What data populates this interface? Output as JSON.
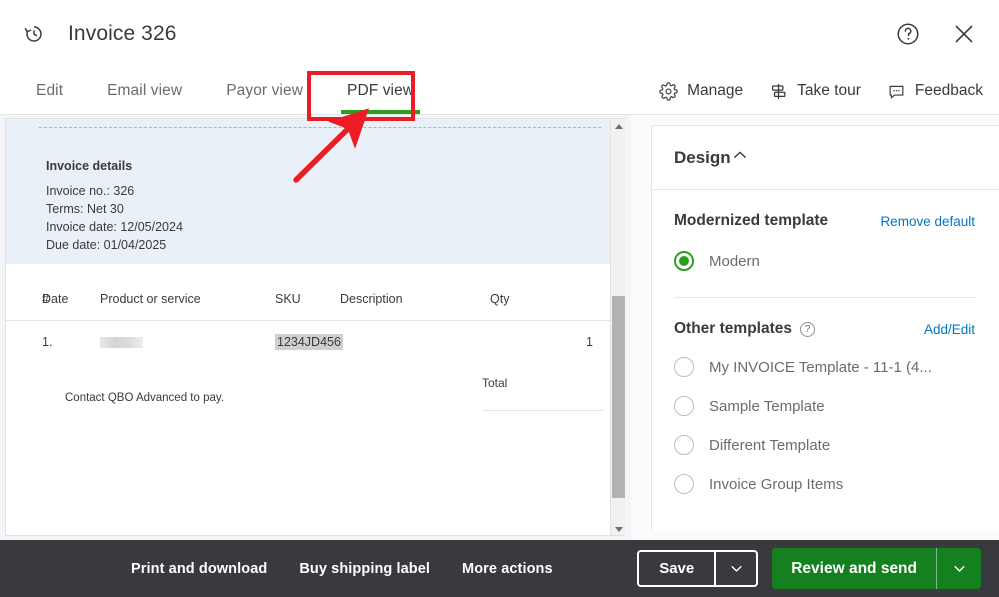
{
  "header": {
    "history_icon": "history-clock-icon",
    "title": "Invoice 326",
    "help_icon": "help-circle-icon",
    "close_icon": "close-x-icon"
  },
  "tabs": [
    {
      "label": "Edit",
      "active": false
    },
    {
      "label": "Email view",
      "active": false
    },
    {
      "label": "Payor view",
      "active": false
    },
    {
      "label": "PDF view",
      "active": true
    }
  ],
  "tools": [
    {
      "label": "Manage",
      "icon": "gear-icon"
    },
    {
      "label": "Take tour",
      "icon": "signpost-icon"
    },
    {
      "label": "Feedback",
      "icon": "speech-bubble-icon"
    }
  ],
  "preview": {
    "details_heading": "Invoice details",
    "invoice_no": "Invoice no.: 326",
    "terms": "Terms: Net 30",
    "invoice_date": "Invoice date: 12/05/2024",
    "due_date": "Due date: 01/04/2025",
    "columns": [
      "#",
      "Date",
      "Product or service",
      "SKU",
      "Description",
      "Qty"
    ],
    "rows": [
      {
        "num": "1.",
        "date": "",
        "product": "",
        "product_redacted": true,
        "sku": "1234JD456",
        "sku_highlighted": true,
        "description": "",
        "qty": "1"
      }
    ],
    "footer_note": "Contact QBO Advanced to pay.",
    "total_label": "Total",
    "total_value": "",
    "scrollbar": {
      "up_icon": "scroll-up-arrow-icon",
      "down_icon": "scroll-down-arrow-icon"
    }
  },
  "design_panel": {
    "title": "Design",
    "collapse_icon": "chevron-up-icon",
    "modernized": {
      "heading": "Modernized template",
      "action_label": "Remove default",
      "options": [
        {
          "label": "Modern",
          "selected": true
        }
      ]
    },
    "other": {
      "heading": "Other templates",
      "help_icon": "help-circle-icon",
      "help_glyph": "?",
      "action_label": "Add/Edit",
      "options": [
        {
          "label": "My INVOICE Template - 11-1 (4...",
          "selected": false
        },
        {
          "label": "Sample Template",
          "selected": false
        },
        {
          "label": "Different Template",
          "selected": false
        },
        {
          "label": "Invoice Group Items",
          "selected": false
        }
      ]
    }
  },
  "bottom_bar": {
    "links": [
      "Print and download",
      "Buy shipping label",
      "More actions"
    ],
    "save_label": "Save",
    "save_caret_icon": "chevron-down-icon",
    "primary_label": "Review and send",
    "primary_caret_icon": "chevron-down-icon"
  },
  "annotations": {
    "highlight_color": "#ec1c24",
    "highlight_target": "PDF view",
    "arrow_icon": "red-pointer-arrow"
  },
  "colors": {
    "accent_green": "#2ca01c",
    "primary_green": "#14801f",
    "link_blue": "#0077c5",
    "dark_bar": "#393a3d",
    "panel_blue": "#eaf0f8"
  }
}
